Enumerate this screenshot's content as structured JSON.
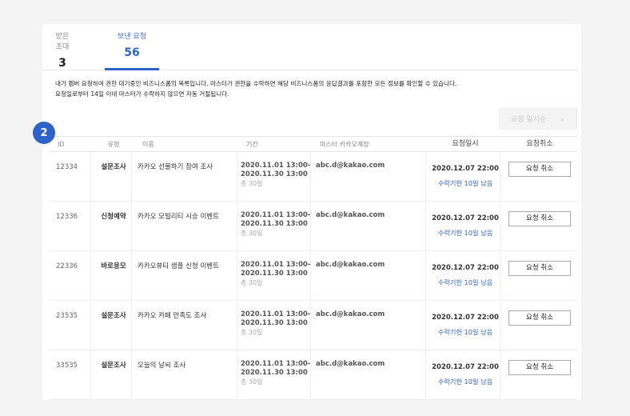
{
  "tabs": [
    {
      "label": "받은 초대",
      "count": "3"
    },
    {
      "label": "보낸 요청",
      "count": "56"
    }
  ],
  "description": {
    "line1": "내가 멤버 요청하여 권한 대기중인 비즈니스폼의 목록입니다. 마스터가 권한을 수락하면 해당 비즈니스폼의 응답결과를 포함한 모든 정보를 확인할 수 있습니다.",
    "line2": "요청일로부터 14일 이내 마스터가 수락하지 않으면 자동 거절됩니다."
  },
  "sort": {
    "selected": "요청 일시순"
  },
  "step_badge": "2",
  "columns": {
    "id": "ID",
    "type": "유형",
    "name": "이름",
    "period": "기간",
    "master": "마스터 카카오계정",
    "requested": "요청일시",
    "cancel": "요청취소"
  },
  "rows": [
    {
      "id": "12334",
      "type": "설문조사",
      "name": "카카오 선물하기 참여 조사",
      "period_start": "2020.11.01 13:00-",
      "period_end": "2020.11.30 13:00",
      "period_total": "총 30일",
      "email": "abc.d@kakao.com",
      "requested": "2020.12.07 22:00",
      "deadline": "수락기한 10일 남음",
      "cancel_label": "요청 취소"
    },
    {
      "id": "12336",
      "type": "신청예약",
      "name": "카카오 모빌리티 시승 이벤트",
      "period_start": "2020.11.01 13:00-",
      "period_end": "2020.11.30 13:00",
      "period_total": "총 30일",
      "email": "abc.d@kakao.com",
      "requested": "2020.12.07 22:00",
      "deadline": "수락기한 10일 남음",
      "cancel_label": "요청 취소"
    },
    {
      "id": "22336",
      "type": "바로응모",
      "name": "카카오뷰티 샘플 신청 이벤트",
      "period_start": "2020.11.01 13:00-",
      "period_end": "2020.11.30 13:00",
      "period_total": "총 30일",
      "email": "abc.d@kakao.com",
      "requested": "2020.12.07 22:00",
      "deadline": "수락기한 10일 남음",
      "cancel_label": "요청 취소"
    },
    {
      "id": "23535",
      "type": "설문조사",
      "name": "카카오 카페 만족도 조사",
      "period_start": "2020.11.01 13:00-",
      "period_end": "2020.11.30 13:00",
      "period_total": "총 30일",
      "email": "abc.d@kakao.com",
      "requested": "2020.12.07 22:00",
      "deadline": "수락기한 10일 남음",
      "cancel_label": "요청 취소"
    },
    {
      "id": "33535",
      "type": "설문조사",
      "name": "오늘의 날씨 조사",
      "period_start": "2020.11.01 13:00-",
      "period_end": "2020.11.30 13:00",
      "period_total": "총 30일",
      "email": "abc.d@kakao.com",
      "requested": "2020.12.07 22:00",
      "deadline": "수락기한 10일 남음",
      "cancel_label": "요청 취소"
    }
  ]
}
